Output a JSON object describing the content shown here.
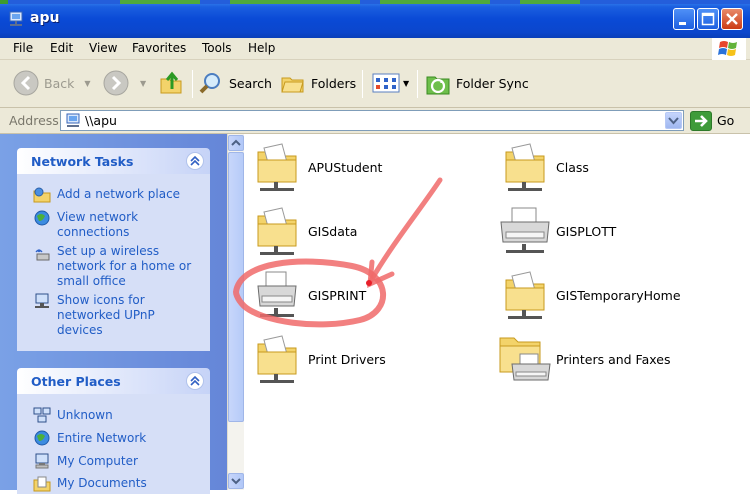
{
  "window": {
    "title": "apu"
  },
  "menu": [
    "File",
    "Edit",
    "View",
    "Favorites",
    "Tools",
    "Help"
  ],
  "toolbar": {
    "back": "Back",
    "search": "Search",
    "folders": "Folders",
    "folder_sync": "Folder Sync"
  },
  "address": {
    "label": "Address",
    "value": "\\\\apu",
    "go": "Go"
  },
  "network_tasks": {
    "title": "Network Tasks",
    "items": [
      {
        "label": "Add a network place",
        "icon": "add-network-place-icon"
      },
      {
        "label": "View network connections",
        "icon": "network-connections-icon"
      },
      {
        "label": "Set up a wireless network for a home or small office",
        "icon": "wireless-network-icon"
      },
      {
        "label": "Show icons for networked UPnP devices",
        "icon": "upnp-devices-icon"
      }
    ]
  },
  "other_places": {
    "title": "Other Places",
    "items": [
      {
        "label": "Unknown",
        "icon": "workgroup-icon"
      },
      {
        "label": "Entire Network",
        "icon": "entire-network-icon"
      },
      {
        "label": "My Computer",
        "icon": "my-computer-icon"
      },
      {
        "label": "My Documents",
        "icon": "my-documents-icon"
      }
    ]
  },
  "shares": [
    {
      "label": "APUStudent",
      "type": "shared-folder"
    },
    {
      "label": "Class",
      "type": "shared-folder"
    },
    {
      "label": "GISdata",
      "type": "shared-folder"
    },
    {
      "label": "GISPLOTT",
      "type": "printer"
    },
    {
      "label": "GISPRINT",
      "type": "printer"
    },
    {
      "label": "GISTemporaryHome",
      "type": "shared-folder"
    },
    {
      "label": "Print Drivers",
      "type": "shared-folder"
    },
    {
      "label": "Printers and Faxes",
      "type": "printers-folder"
    }
  ],
  "colors": {
    "title_bar": "#0a4ad6",
    "task_pane": "#6586d8",
    "task_link": "#215dc6",
    "annotation": "#f06a6a"
  }
}
